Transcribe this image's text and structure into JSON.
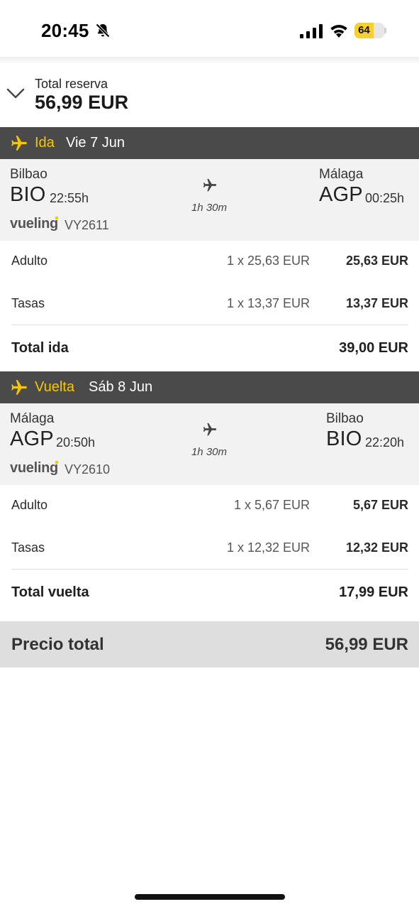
{
  "status_bar": {
    "time": "20:45",
    "battery": "64",
    "battery_level": 0.64
  },
  "summary": {
    "label": "Total reserva",
    "amount": "56,99 EUR"
  },
  "outbound": {
    "direction": "Ida",
    "date": "Vie 7 Jun",
    "origin_city": "Bilbao",
    "origin_code": "BIO",
    "departure_time": "22:55h",
    "destination_city": "Málaga",
    "destination_code": "AGP",
    "arrival_time": "00:25h",
    "duration": "1h 30m",
    "airline": "vueling",
    "flight_number": "VY2611",
    "rows": [
      {
        "label": "Adulto",
        "calc": "1 x 25,63 EUR",
        "amount": "25,63 EUR"
      },
      {
        "label": "Tasas",
        "calc": "1 x 13,37 EUR",
        "amount": "13,37 EUR"
      }
    ],
    "total_label": "Total ida",
    "total_amount": "39,00 EUR"
  },
  "return": {
    "direction": "Vuelta",
    "date": "Sáb 8 Jun",
    "origin_city": "Málaga",
    "origin_code": "AGP",
    "departure_time": "20:50h",
    "destination_city": "Bilbao",
    "destination_code": "BIO",
    "arrival_time": "22:20h",
    "duration": "1h 30m",
    "airline": "vueling",
    "flight_number": "VY2610",
    "rows": [
      {
        "label": "Adulto",
        "calc": "1 x 5,67 EUR",
        "amount": "5,67 EUR"
      },
      {
        "label": "Tasas",
        "calc": "1 x 12,32 EUR",
        "amount": "12,32 EUR"
      }
    ],
    "total_label": "Total vuelta",
    "total_amount": "17,99 EUR"
  },
  "grand_total": {
    "label": "Precio total",
    "amount": "56,99 EUR"
  },
  "colors": {
    "accent": "#f7c600",
    "section_bar": "#4a4a4a",
    "card_bg": "#f2f2f2",
    "grand_bg": "#dedede"
  }
}
